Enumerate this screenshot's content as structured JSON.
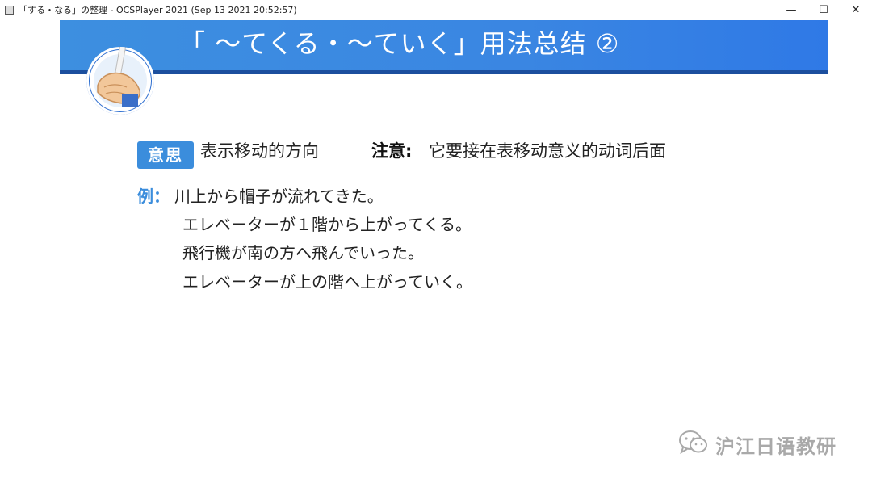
{
  "window": {
    "title": "「する・なる」の整理 - OCSPlayer 2021 (Sep 13 2021 20:52:57)",
    "minimize_glyph": "—",
    "maximize_glyph": "☐",
    "close_glyph": "✕"
  },
  "slide": {
    "title": "「 ～てくる・～ていく」用法总结 ②",
    "meaning_tag": "意思",
    "meaning_text": "表示移动的方向",
    "note_label": "注意:",
    "note_text": "它要接在表移动意义的动词后面",
    "example_label": "例：",
    "examples": [
      "川上から帽子が流れてきた。",
      "エレベーターが１階から上がってくる。",
      "飛行機が南の方へ飛んでいった。",
      "エレベーターが上の階へ上がっていく。"
    ]
  },
  "watermark": {
    "text": "沪江日语教研",
    "icon": "wechat-icon"
  },
  "colors": {
    "banner": "#3a86e2",
    "banner_line": "#1c4f9e",
    "accent": "#3b8ddc",
    "watermark": "#a9a9a9"
  }
}
